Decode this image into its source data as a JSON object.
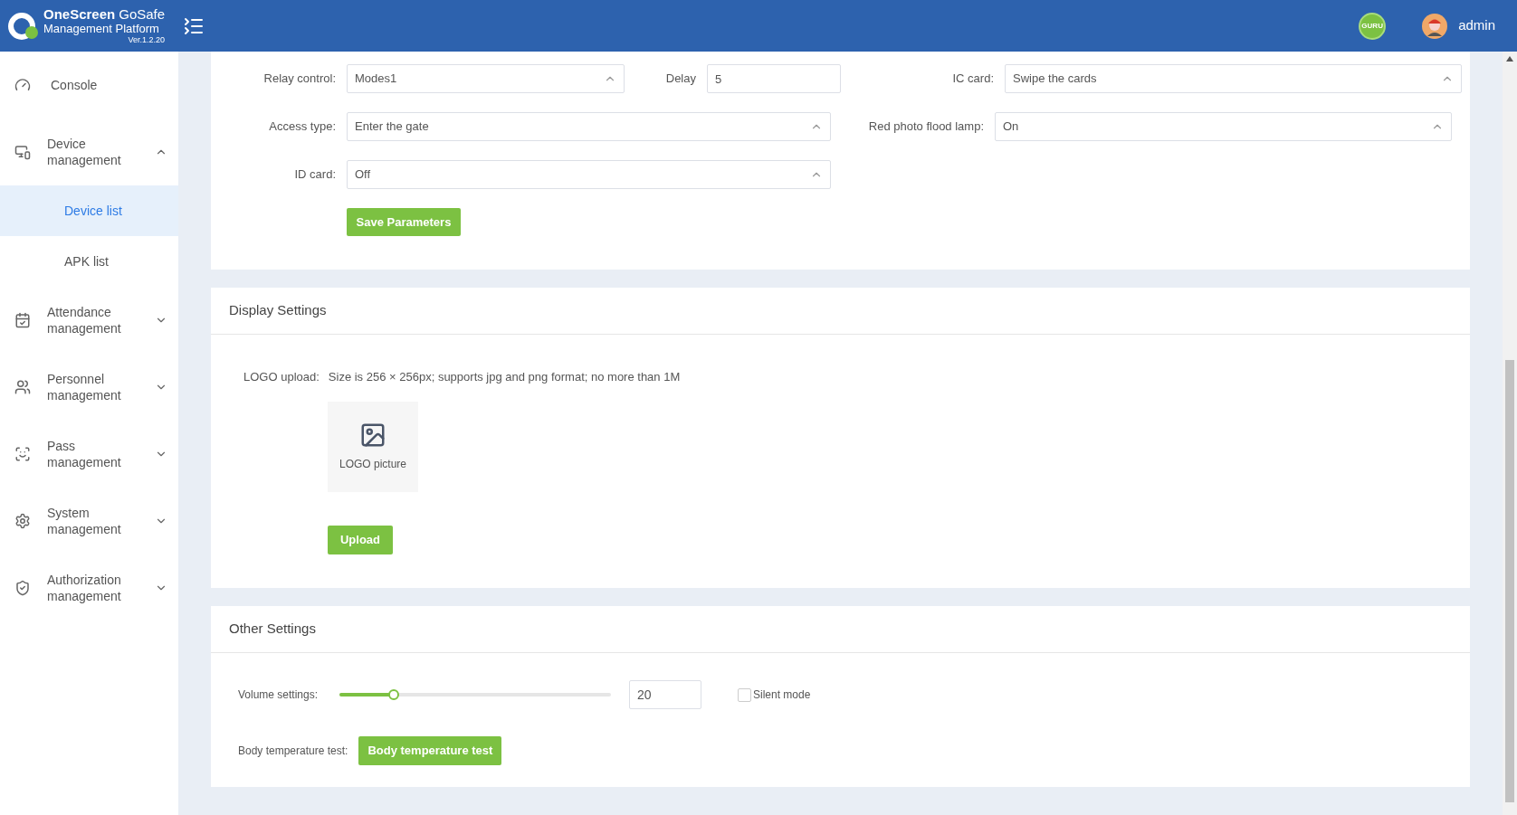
{
  "header": {
    "brand": "OneScreen",
    "product": "GoSafe",
    "subtitle": "Management Platform",
    "version": "Ver.1.2.20",
    "badge": "GURU",
    "user": "admin"
  },
  "sidebar": {
    "items": [
      {
        "label": "Console"
      },
      {
        "label": "Device management",
        "expanded": true,
        "children": [
          {
            "label": "Device list",
            "selected": true
          },
          {
            "label": "APK list",
            "selected": false
          }
        ]
      },
      {
        "label": "Attendance management",
        "expanded": false
      },
      {
        "label": "Personnel management",
        "expanded": false
      },
      {
        "label": "Pass management",
        "expanded": false
      },
      {
        "label": "System management",
        "expanded": false
      },
      {
        "label": "Authorization management",
        "expanded": false
      }
    ]
  },
  "parameters": {
    "relay_control": {
      "label": "Relay control:",
      "value": "Modes1"
    },
    "delay": {
      "label": "Delay",
      "value": "5"
    },
    "ic_card": {
      "label": "IC card:",
      "value": "Swipe the cards"
    },
    "access_type": {
      "label": "Access type:",
      "value": "Enter the gate"
    },
    "red_photo_flood_lamp": {
      "label": "Red photo flood lamp:",
      "value": "On"
    },
    "id_card": {
      "label": "ID card:",
      "value": "Off"
    },
    "save_button": "Save Parameters"
  },
  "display_settings": {
    "title": "Display Settings",
    "logo_label": "LOGO upload:",
    "logo_hint": "Size is 256 × 256px; supports jpg and png format; no more than 1M",
    "logo_placeholder": "LOGO picture",
    "upload_button": "Upload"
  },
  "other_settings": {
    "title": "Other Settings",
    "volume_label": "Volume settings:",
    "volume": {
      "level": 0.2,
      "value": "20"
    },
    "silent_mode": {
      "label": "Silent mode",
      "checked": false
    },
    "body_temp_label": "Body temperature test:",
    "body_temp_button": "Body temperature test"
  }
}
